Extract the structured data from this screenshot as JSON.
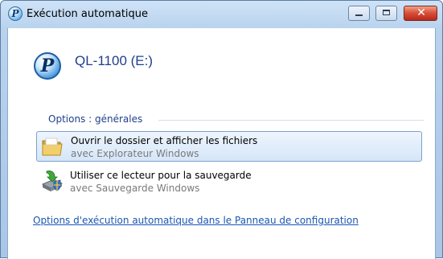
{
  "window": {
    "title": "Exécution automatique",
    "icons": {
      "app": "autoplay-pen-icon"
    },
    "controls": {
      "minimize": "minimize-icon",
      "maximize": "maximize-icon",
      "close": "close-icon"
    },
    "colors": {
      "close_button": "#c9412c",
      "link": "#1a56b3",
      "heading": "#1e3f8c"
    }
  },
  "device": {
    "name": "QL-1100 (E:)",
    "icon": "pen-logo-icon",
    "icon_letter": "P"
  },
  "options_group": {
    "label": "Options : générales",
    "items": [
      {
        "title": "Ouvrir le dossier et afficher les fichiers",
        "subtitle": "avec Explorateur Windows",
        "icon": "folder-icon",
        "selected": true
      },
      {
        "title": "Utiliser ce lecteur pour la sauvegarde",
        "subtitle": "avec Sauvegarde Windows",
        "icon": "backup-icon",
        "selected": false
      }
    ]
  },
  "control_panel_link": "Options d'exécution automatique dans le Panneau de configuration"
}
